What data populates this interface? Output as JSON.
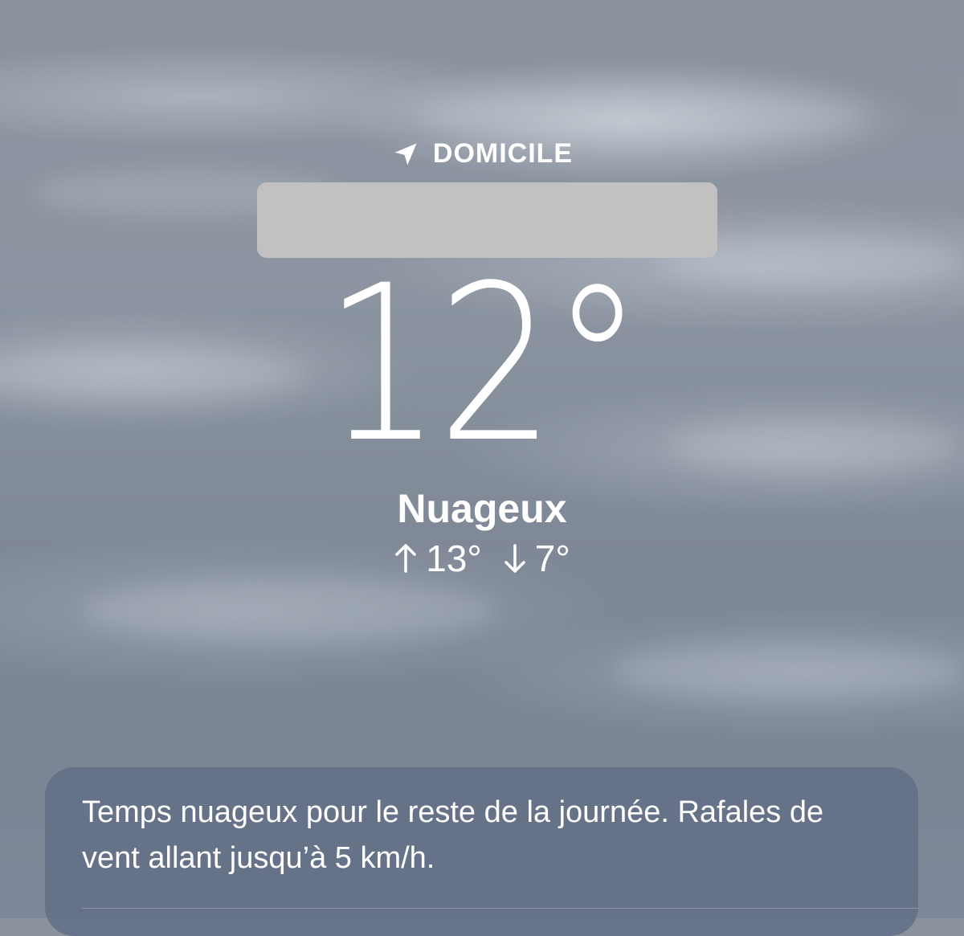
{
  "location": {
    "label": "DOMICILE",
    "icon": "location-arrow-icon"
  },
  "current": {
    "temperature": "12°",
    "condition": "Nuageux",
    "high": "13°",
    "low": "7°",
    "high_icon": "arrow-up-icon",
    "low_icon": "arrow-down-icon"
  },
  "summary": {
    "text": "Temps nuageux pour le reste de la journée. Rafales de vent allant jusqu’à 5 km/h."
  },
  "colors": {
    "sky": "#8a929e",
    "card": "#606e84",
    "redaction": "#c1c1c1"
  }
}
